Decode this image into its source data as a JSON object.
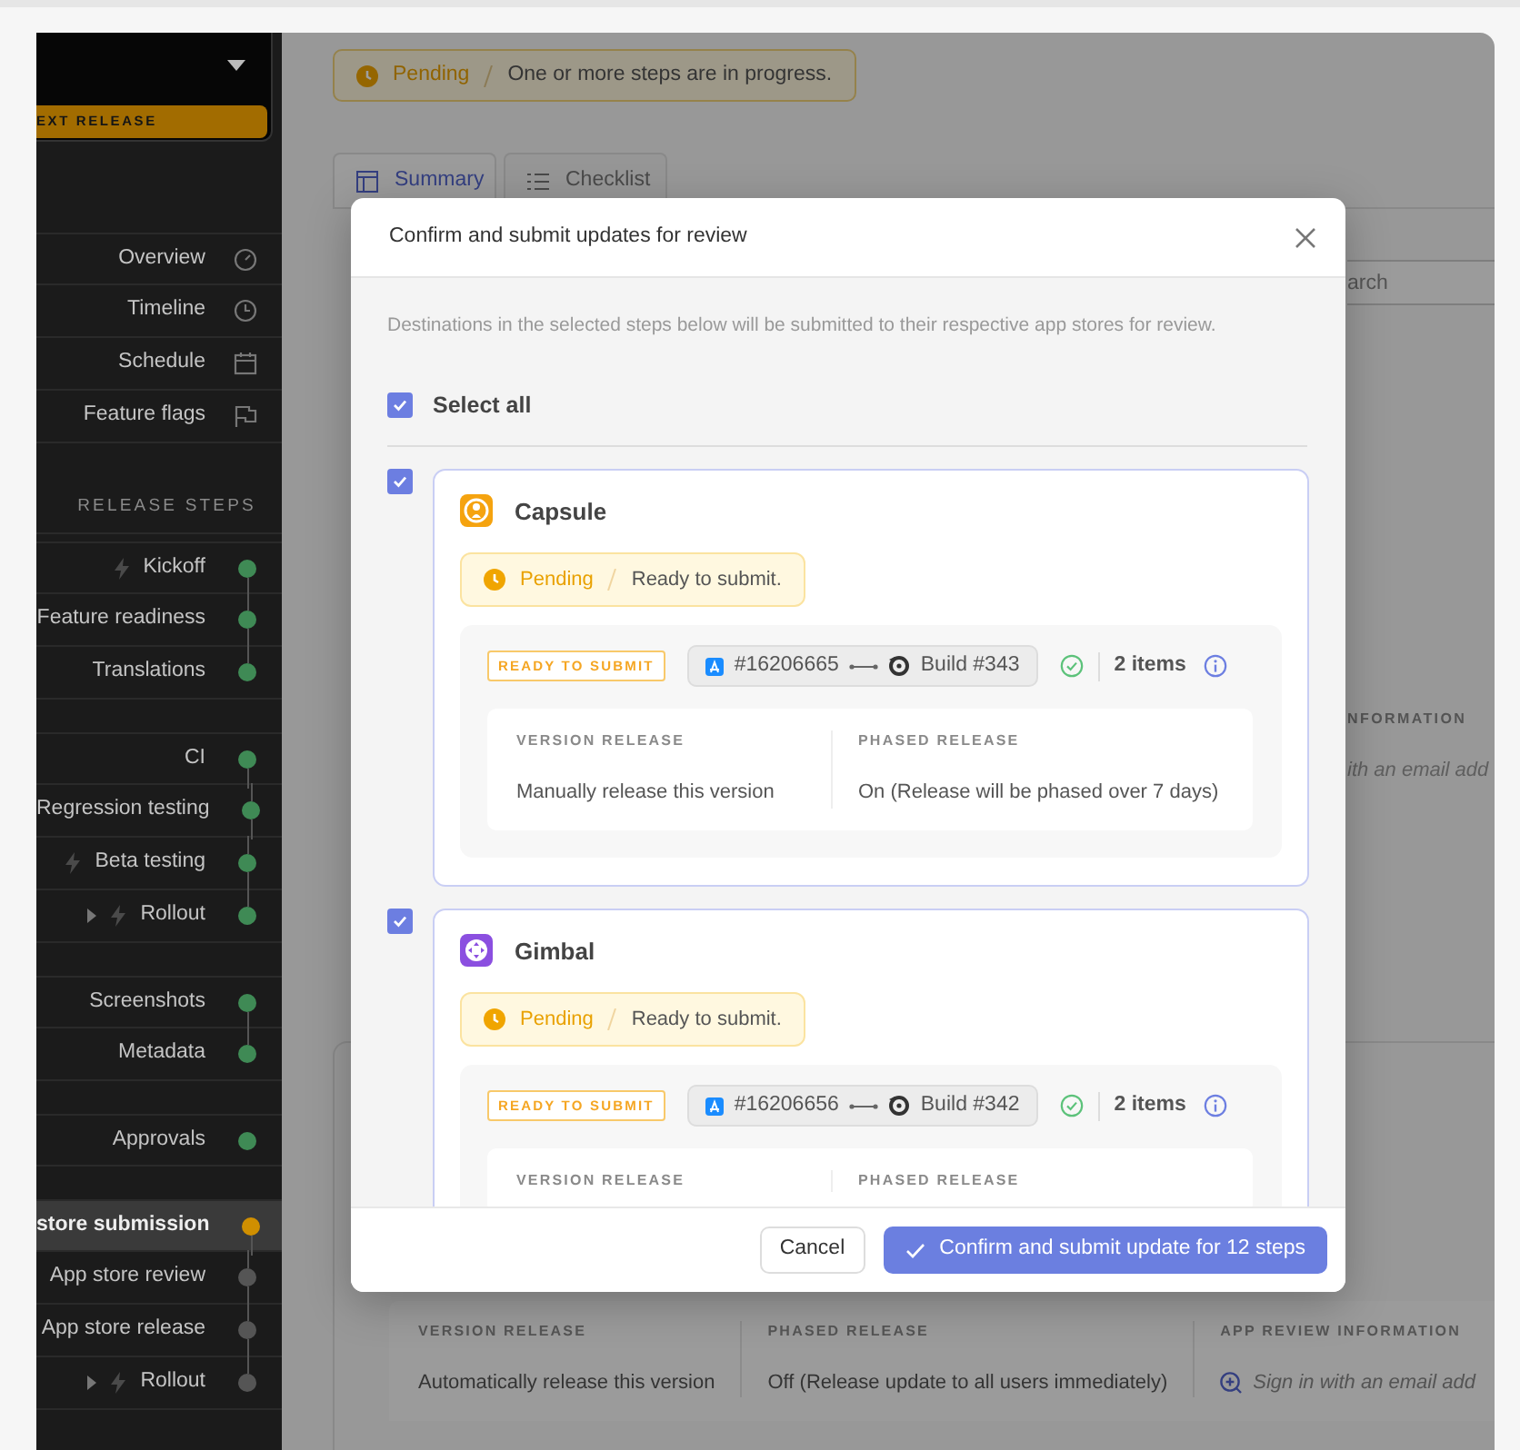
{
  "sidebar": {
    "release_switcher": {
      "badge": "EXT RELEASE"
    },
    "nav_items": [
      {
        "label": "Overview"
      },
      {
        "label": "Timeline"
      },
      {
        "label": "Schedule"
      },
      {
        "label": "Feature flags"
      }
    ],
    "steps_heading": "RELEASE STEPS",
    "step_groups": [
      {
        "steps": [
          {
            "label": "Kickoff",
            "color": "#3f8a55",
            "automated": true,
            "expandable": false,
            "selected": false
          },
          {
            "label": "Feature readiness",
            "color": "#3f8a55",
            "automated": false,
            "expandable": false,
            "selected": false
          },
          {
            "label": "Translations",
            "color": "#3f8a55",
            "automated": false,
            "expandable": false,
            "selected": false
          }
        ]
      },
      {
        "steps": [
          {
            "label": "CI",
            "color": "#3f8a55",
            "automated": false,
            "expandable": false,
            "selected": false
          },
          {
            "label": "Regression testing",
            "color": "#3f8a55",
            "automated": false,
            "expandable": false,
            "selected": false
          },
          {
            "label": "Beta testing",
            "color": "#3f8a55",
            "automated": true,
            "expandable": false,
            "selected": false
          },
          {
            "label": "Rollout",
            "color": "#3f8a55",
            "automated": true,
            "expandable": true,
            "selected": false
          }
        ]
      },
      {
        "steps": [
          {
            "label": "Screenshots",
            "color": "#3f8a55",
            "automated": false,
            "expandable": false,
            "selected": false
          },
          {
            "label": "Metadata",
            "color": "#3f8a55",
            "automated": false,
            "expandable": false,
            "selected": false
          }
        ]
      },
      {
        "steps": [
          {
            "label": "Approvals",
            "color": "#3f8a55",
            "automated": false,
            "expandable": false,
            "selected": false
          }
        ]
      },
      {
        "steps": [
          {
            "label": "store submission",
            "color": "#d08f00",
            "automated": false,
            "expandable": false,
            "selected": true
          },
          {
            "label": "App store review",
            "color": "#555555",
            "automated": false,
            "expandable": false,
            "selected": false
          },
          {
            "label": "App store release",
            "color": "#555555",
            "automated": false,
            "expandable": false,
            "selected": false
          },
          {
            "label": "Rollout",
            "color": "#555555",
            "automated": true,
            "expandable": true,
            "selected": false
          }
        ]
      }
    ]
  },
  "page": {
    "status_banner": {
      "kind": "pending",
      "status": "Pending",
      "message": "One or more steps are in progress."
    },
    "tabs": [
      {
        "label": "Summary",
        "selected": true
      },
      {
        "label": "Checklist",
        "selected": false
      }
    ],
    "search": {
      "placeholder": "arch"
    },
    "peek_column": {
      "heading": "NFORMATION",
      "value": "ith an email add"
    },
    "submission_card": {
      "fields": [
        {
          "label": "VERSION RELEASE",
          "value": "Automatically release this version",
          "kind": "text"
        },
        {
          "label": "PHASED RELEASE",
          "value": "Off (Release update to all users immediately)",
          "kind": "text"
        },
        {
          "label": "APP REVIEW INFORMATION",
          "value": "Sign in with an email add",
          "kind": "link"
        }
      ]
    }
  },
  "modal": {
    "title": "Confirm and submit updates for review",
    "description": "Destinations in the selected steps below will be submitted to their respective app stores for review.",
    "select_all": {
      "label": "Select all",
      "checked": true
    },
    "steps": [
      {
        "name": "Capsule",
        "checked": true,
        "color": "#f5a30f",
        "status": "Pending",
        "status_message": "Ready to submit.",
        "badge": "READY TO SUBMIT",
        "store_id": "#16206665",
        "build": "Build #343",
        "valid": true,
        "count": "2 items",
        "fields": [
          {
            "label": "VERSION RELEASE",
            "value": "Manually release this version"
          },
          {
            "label": "PHASED RELEASE",
            "value": "On (Release will be phased over 7 days)"
          }
        ]
      },
      {
        "name": "Gimbal",
        "checked": true,
        "color": "#8b4fe0",
        "status": "Pending",
        "status_message": "Ready to submit.",
        "badge": "READY TO SUBMIT",
        "store_id": "#16206656",
        "build": "Build #342",
        "valid": true,
        "count": "2 items",
        "fields": [
          {
            "label": "VERSION RELEASE"
          },
          {
            "label": "PHASED RELEASE"
          }
        ]
      }
    ],
    "cancel": "Cancel",
    "confirm": "Confirm and submit update for 12 steps"
  }
}
